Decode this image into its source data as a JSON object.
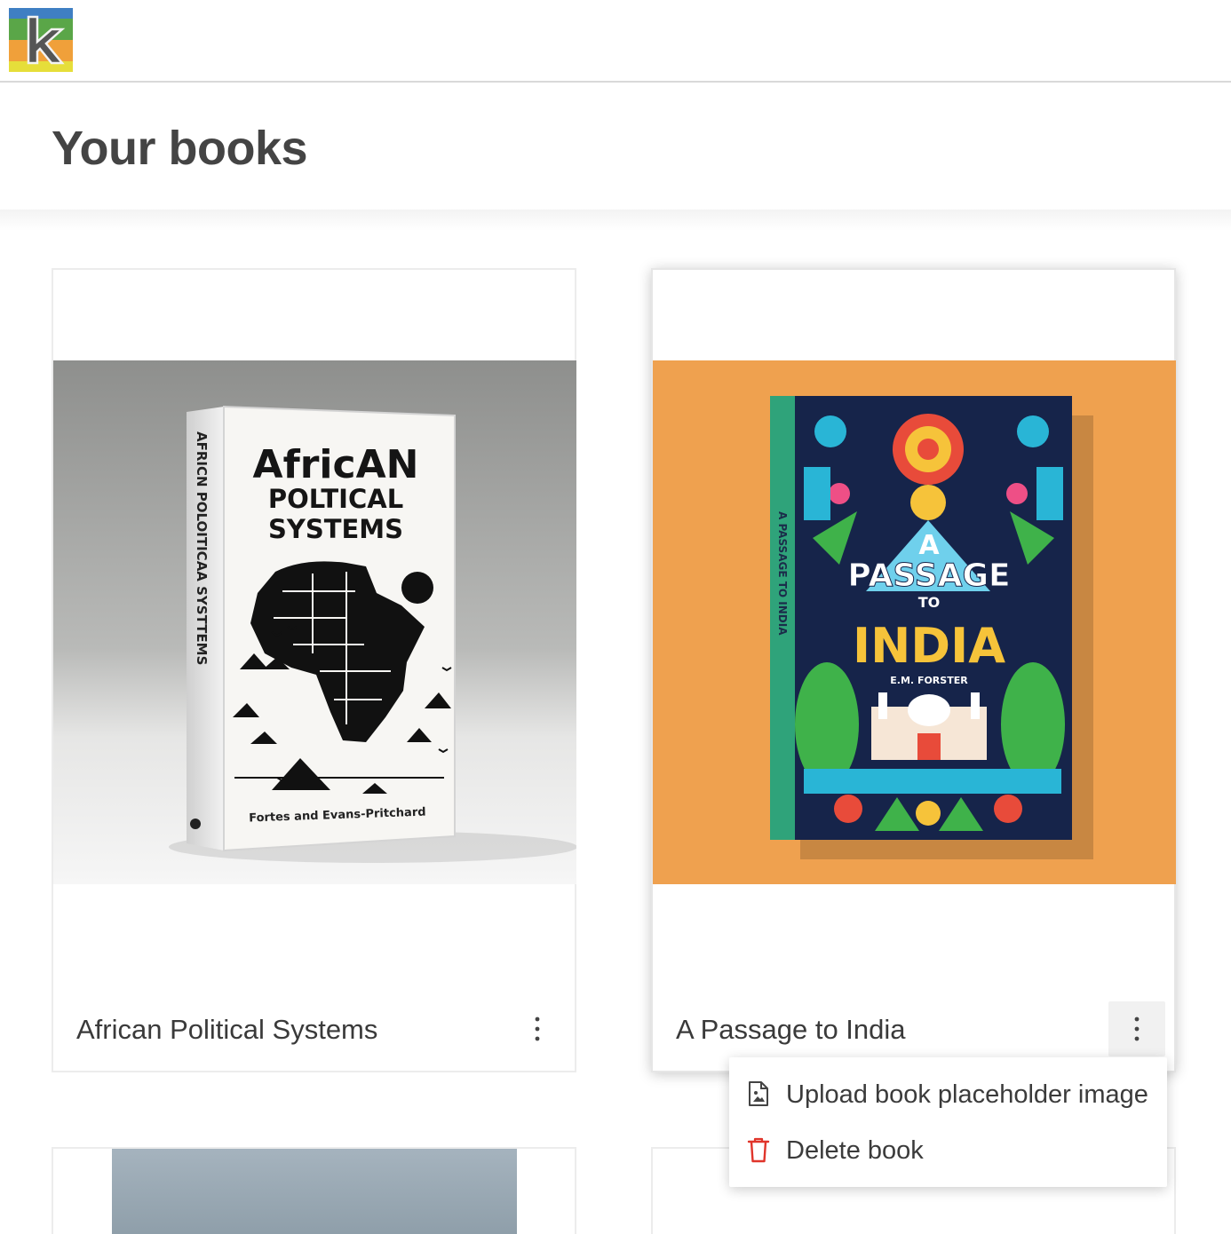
{
  "app": {
    "logo_letter": "k"
  },
  "page": {
    "title": "Your books"
  },
  "books": [
    {
      "title": "African Political Systems",
      "cover": {
        "title_lines": [
          "AfricAN",
          "POLTICAL",
          "SYSTEMS"
        ],
        "spine_text": "AFRICN POLOITICAA SYSTTEMS",
        "author_text": "Fortes and Evans-Pritchard"
      }
    },
    {
      "title": "A Passage to India",
      "cover": {
        "title_lines": [
          "A",
          "PASSAGE",
          "TO",
          "INDIA"
        ],
        "spine_text": "A PASSAGE TO INDIA",
        "author_text": "E.M. FORSTER"
      }
    }
  ],
  "context_menu": {
    "items": [
      {
        "label": "Upload book placeholder image",
        "icon": "image-file-icon"
      },
      {
        "label": "Delete book",
        "icon": "trash-icon"
      }
    ]
  },
  "colors": {
    "logo_stripes": [
      "#3f7fc3",
      "#5aa648",
      "#f0a03a",
      "#e6de3a"
    ],
    "delete_icon": "#e0352b",
    "cover_2_background": "#efa14f"
  }
}
